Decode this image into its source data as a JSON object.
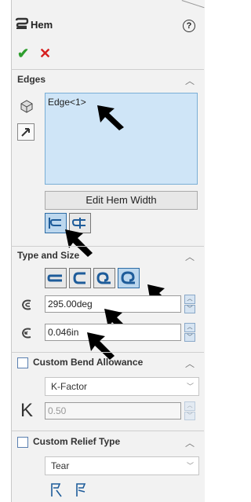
{
  "header": {
    "title": "Hem",
    "help_icon": "?"
  },
  "actions": {
    "ok": "✔",
    "cancel": "✕"
  },
  "edges": {
    "title": "Edges",
    "items": [
      "Edge<1>"
    ],
    "edit_button": "Edit Hem Width"
  },
  "type_size": {
    "title": "Type and Size",
    "angle_value": "295.00deg",
    "radius_value": "0.046in"
  },
  "custom_bend": {
    "title": "Custom Bend Allowance",
    "type_value": "K-Factor",
    "k_label": "K",
    "k_value": "0.50"
  },
  "custom_relief": {
    "title": "Custom Relief Type",
    "type_value": "Tear"
  },
  "colors": {
    "ok": "#2e9e2e",
    "cancel": "#d62020",
    "selection": "#cfe5f7"
  }
}
